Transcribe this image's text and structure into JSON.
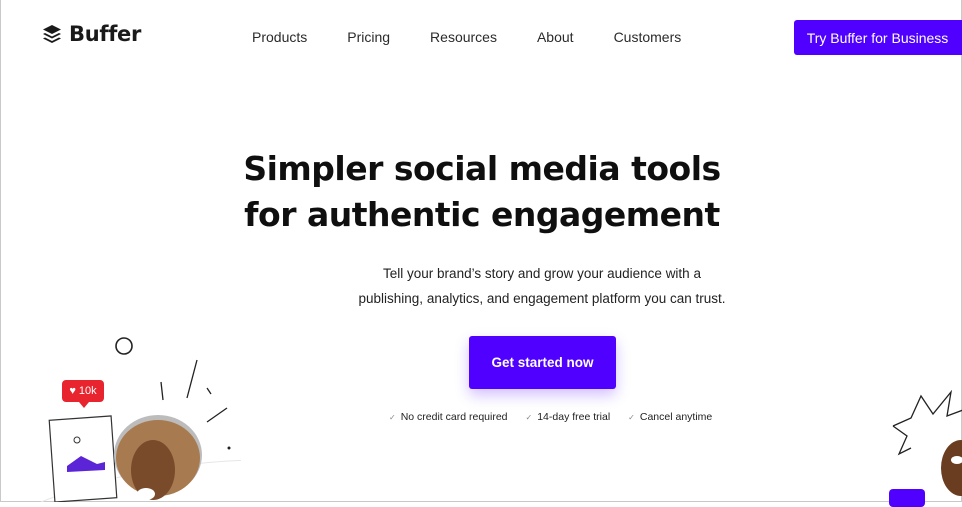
{
  "brand": {
    "name": "Buffer"
  },
  "nav": {
    "items": [
      "Products",
      "Pricing",
      "Resources",
      "About",
      "Customers"
    ]
  },
  "header": {
    "cta_label": "Try Buffer for Business"
  },
  "hero": {
    "title_line1": "Simpler social media tools",
    "title_line2": "for authentic engagement",
    "subtitle_line1": "Tell your brand’s story and grow your audience with a",
    "subtitle_line2": "publishing, analytics, and engagement platform you can trust.",
    "cta_label": "Get started now",
    "checks": [
      "No credit card required",
      "14-day free trial",
      "Cancel anytime"
    ]
  },
  "illustration": {
    "likes_badge": "10k"
  },
  "colors": {
    "accent": "#5000ff",
    "heart": "#e8242f"
  }
}
